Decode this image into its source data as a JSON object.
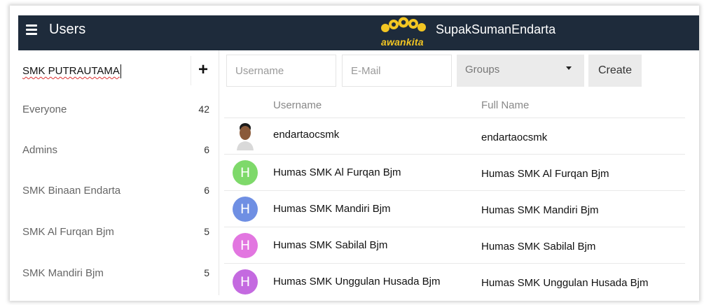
{
  "header": {
    "title": "Users",
    "logo_text": "awankita",
    "brand": "SupakSumanEndarta",
    "bar_color": "#1e2b3b",
    "logo_color": "#f3c623"
  },
  "sidebar": {
    "group_input_value": "SMK PUTRAUTAMA",
    "add_label": "+",
    "groups": [
      {
        "name": "Everyone",
        "count": "42"
      },
      {
        "name": "Admins",
        "count": "6"
      },
      {
        "name": "SMK Binaan Endarta",
        "count": "6"
      },
      {
        "name": "SMK Al Furqan Bjm",
        "count": "5"
      },
      {
        "name": "SMK Mandiri Bjm",
        "count": "5"
      }
    ]
  },
  "toolbar": {
    "username_placeholder": "Username",
    "email_placeholder": "E-Mail",
    "groups_label": "Groups",
    "create_label": "Create"
  },
  "table": {
    "headers": {
      "username": "Username",
      "fullname": "Full Name"
    },
    "rows": [
      {
        "avatar": "",
        "avatar_type": "photo",
        "username": "endartaocsmk",
        "fullname": "endartaocsmk"
      },
      {
        "avatar": "H",
        "avatar_color": "#7ed96a",
        "username": "Humas SMK Al Furqan Bjm",
        "fullname": "Humas SMK Al Furqan Bjm"
      },
      {
        "avatar": "H",
        "avatar_color": "#6f8fe3",
        "username": "Humas SMK Mandiri Bjm",
        "fullname": "Humas SMK Mandiri Bjm"
      },
      {
        "avatar": "H",
        "avatar_color": "#e276e0",
        "username": "Humas SMK Sabilal Bjm",
        "fullname": "Humas SMK Sabilal Bjm"
      },
      {
        "avatar": "H",
        "avatar_color": "#c46ae0",
        "username": "Humas SMK Unggulan Husada Bjm",
        "fullname": "Humas SMK Unggulan Husada Bjm"
      }
    ]
  }
}
